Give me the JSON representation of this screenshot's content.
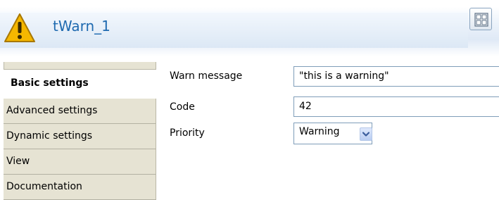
{
  "header": {
    "title": "tWarn_1",
    "icon": "warning-triangle-icon",
    "layout_button_icon": "layout-grid-icon"
  },
  "tabs": [
    {
      "label": "Basic settings",
      "active": true
    },
    {
      "label": "Advanced settings",
      "active": false
    },
    {
      "label": "Dynamic settings",
      "active": false
    },
    {
      "label": "View",
      "active": false
    },
    {
      "label": "Documentation",
      "active": false
    }
  ],
  "form": {
    "warn_message": {
      "label": "Warn message",
      "value": "\"this is a warning\""
    },
    "code": {
      "label": "Code",
      "value": "42"
    },
    "priority": {
      "label": "Priority",
      "value": "Warning"
    }
  },
  "colors": {
    "title": "#1f6ab0",
    "tab_bg": "#e6e3d3",
    "input_border": "#7f9db9",
    "warning_fill": "#f5b700"
  }
}
